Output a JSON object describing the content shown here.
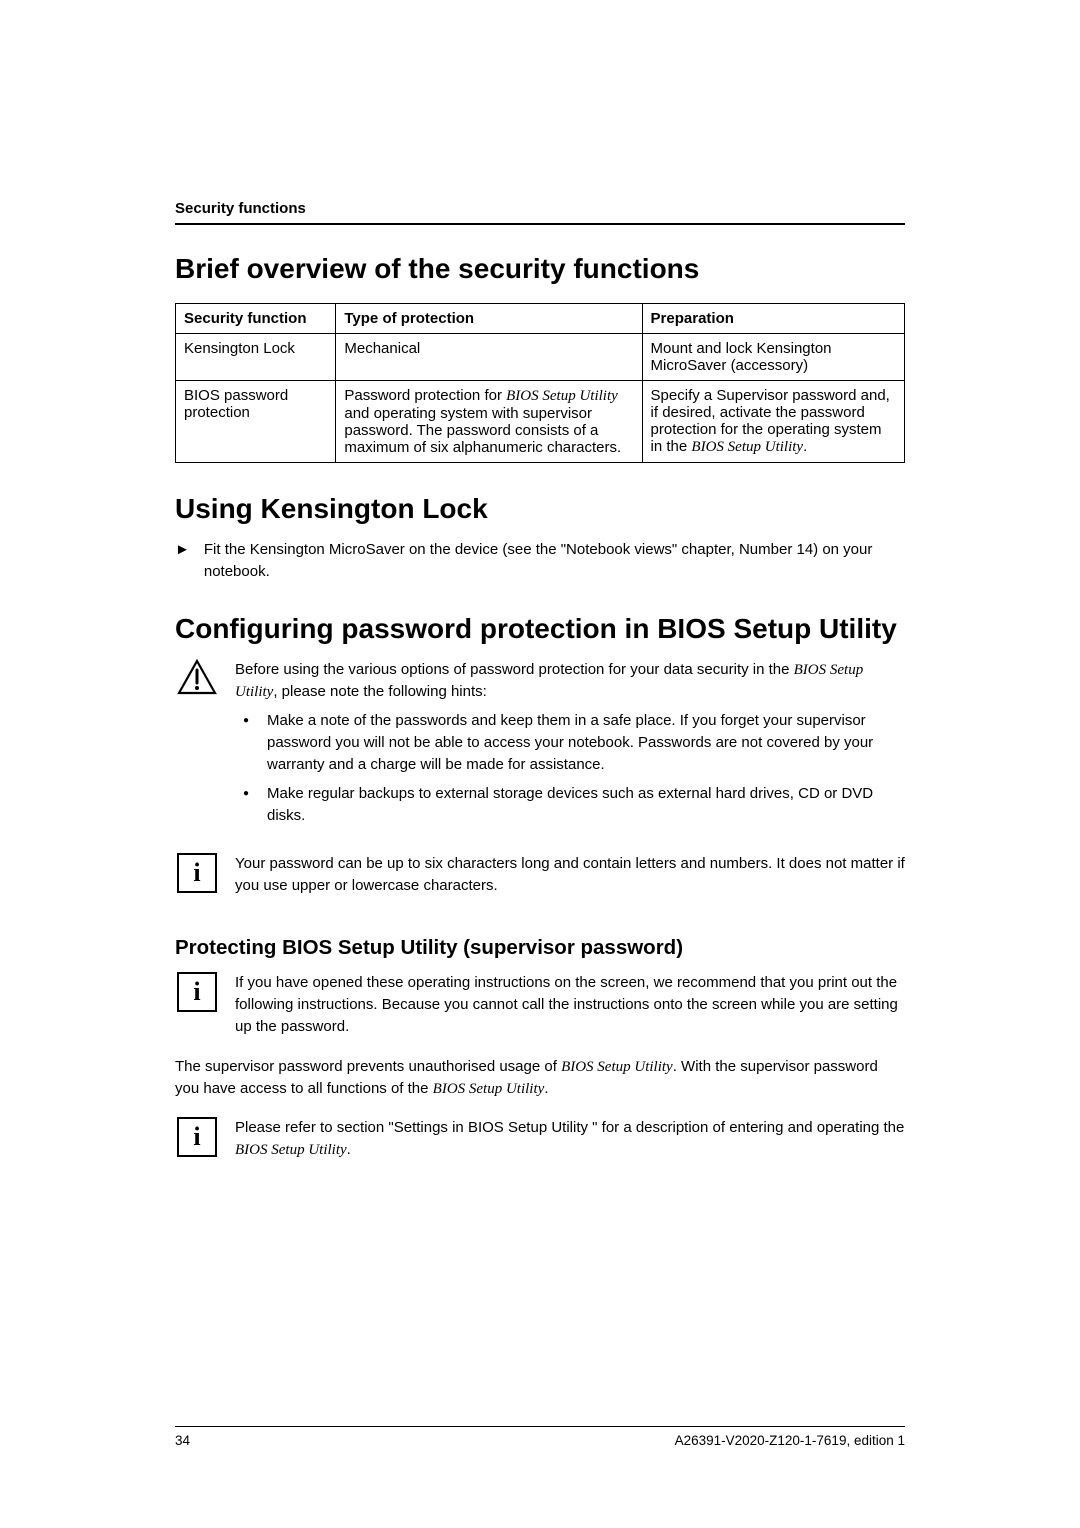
{
  "header": {
    "section_label": "Security functions"
  },
  "h1": "Brief overview of the security functions",
  "table": {
    "headers": {
      "c1": "Security function",
      "c2": "Type of protection",
      "c3": "Preparation"
    },
    "rows": [
      {
        "c1": "Kensington Lock",
        "c2": "Mechanical",
        "c3": "Mount and lock Kensington MicroSaver (accessory)"
      },
      {
        "c1": "BIOS password protection",
        "c2_pre": "Password protection for ",
        "c2_it1": "BIOS Setup Utility",
        "c2_post": " and operating system with supervisor password. The password consists of a maximum of six alphanumeric characters.",
        "c3_pre": "Specify a Supervisor password and, if desired, activate the password protection for the operating system in the ",
        "c3_it1": "BIOS Setup Utility",
        "c3_post": "."
      }
    ]
  },
  "h2a": "Using Kensington Lock",
  "step1": "Fit the Kensington MicroSaver on the device (see the \"Notebook views\" chapter, Number 14) on your notebook.",
  "h2b": "Configuring password protection in BIOS Setup Utility",
  "warn": {
    "intro_pre": "Before using the various options of password protection for your data security in the ",
    "intro_it": "BIOS Setup Utility",
    "intro_post": ", please note the following hints:",
    "b1": "Make a note of the passwords and keep them in a safe place. If you forget your supervisor password you will not be able to access your notebook. Passwords are not covered by your warranty and a charge will be made for assistance.",
    "b2": "Make regular backups to external storage devices such as external hard drives, CD or DVD disks."
  },
  "info1": "Your password can be up to six characters long and contain letters and numbers. It does not matter if you use upper or lowercase characters.",
  "h3a": "Protecting BIOS Setup Utility (supervisor password)",
  "info2": "If you have opened these operating instructions on the screen, we recommend that you print out the following instructions. Because you cannot call the instructions onto the screen while you are setting up the password.",
  "para1_pre": "The supervisor password prevents unauthorised usage of ",
  "para1_it": "BIOS Setup Utility",
  "para1_mid": ". With the supervisor password you have access to all functions of the ",
  "para1_it2": "BIOS Setup Utility",
  "para1_post": ".",
  "info3_pre": "Please refer to section \"Settings in BIOS Setup Utility \" for a description of entering and operating the ",
  "info3_it": "BIOS Setup Utility",
  "info3_post": ".",
  "footer": {
    "page": "34",
    "doc": "A26391-V2020-Z120-1-7619, edition 1"
  }
}
